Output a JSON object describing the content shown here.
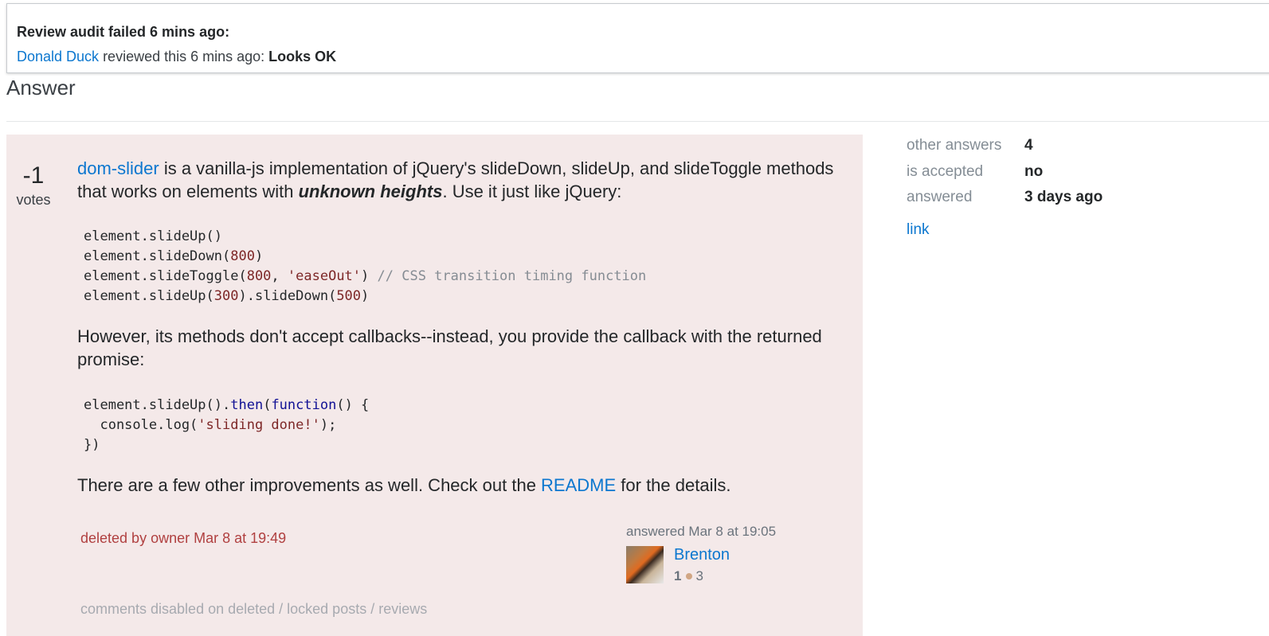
{
  "audit": {
    "title": "Review audit failed 6 mins ago:",
    "reviewer": "Donald Duck",
    "reviewed_text": " reviewed this 6 mins ago: ",
    "result": "Looks OK"
  },
  "answer_heading": "Answer",
  "post": {
    "vote_count": "-1",
    "vote_label": "votes",
    "intro_link": "dom-slider",
    "intro_text_1": " is a vanilla-js implementation of jQuery's slideDown, slideUp, and slideToggle methods that works on elements with ",
    "intro_emphasis": "unknown heights",
    "intro_text_2": ". Use it just like jQuery:",
    "code1": {
      "line1": "element.slideUp()",
      "line2_a": "element.slideDown(",
      "line2_num": "800",
      "line2_b": ")",
      "line3_a": "element.slideToggle(",
      "line3_num": "800",
      "line3_sep": ", ",
      "line3_str": "'easeOut'",
      "line3_b": ") ",
      "line3_comment": "// CSS transition timing function",
      "line4_a": "element.slideUp(",
      "line4_num1": "300",
      "line4_b": ").slideDown(",
      "line4_num2": "500",
      "line4_c": ")"
    },
    "p2": "However, its methods don't accept callbacks--instead, you provide the callback with the returned promise:",
    "code2": {
      "line1_a": "element.slideUp().",
      "line1_kw1": "then",
      "line1_b": "(",
      "line1_kw2": "function",
      "line1_c": "() {",
      "line2_a": "  console.log(",
      "line2_str": "'sliding done!'",
      "line2_b": ");",
      "line3": "})"
    },
    "p3_text_1": "There are a few other improvements as well. Check out the ",
    "p3_link": "README",
    "p3_text_2": " for the details.",
    "deleted_notice": "deleted by owner Mar 8 at 19:49",
    "comments_disabled": "comments disabled on deleted / locked posts / reviews",
    "signature": {
      "action_time": "answered Mar 8 at 19:05",
      "user_name": "Brenton",
      "reputation": "1",
      "bronze_badges": "3"
    }
  },
  "sidebar": {
    "rows": [
      {
        "label": "other answers",
        "value": "4"
      },
      {
        "label": "is accepted",
        "value": "no"
      },
      {
        "label": "answered",
        "value": "3 days ago"
      }
    ],
    "link_label": "link"
  },
  "colors": {
    "link": "#0c77cf",
    "deleted_background": "#f4e9e9",
    "deleted_text": "#b04040",
    "bronze_badge": "#d1a684"
  }
}
